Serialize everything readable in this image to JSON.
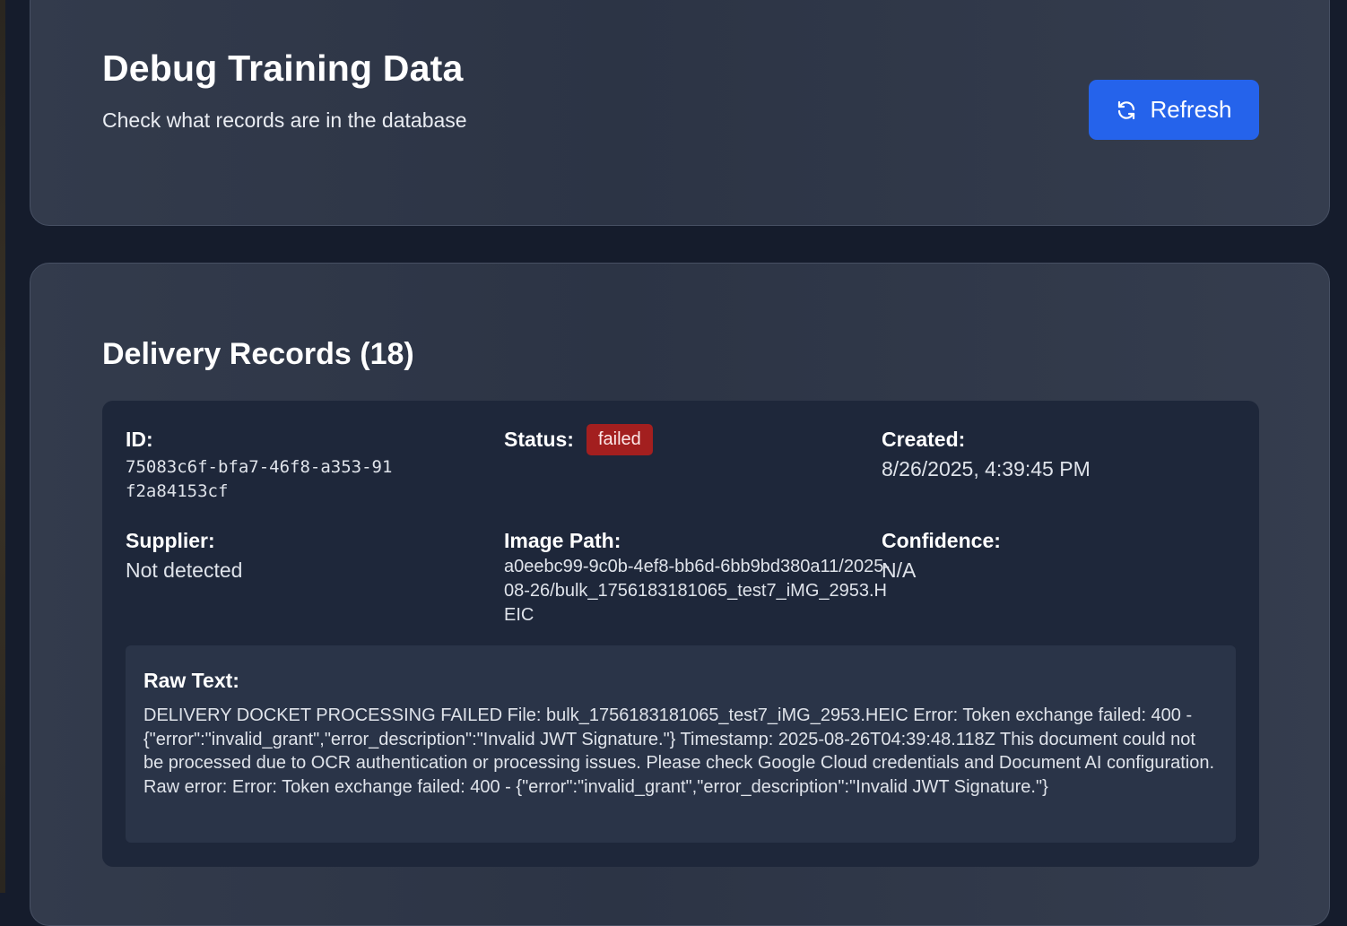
{
  "header": {
    "title": "Debug Training Data",
    "subtitle": "Check what records are in the database",
    "refresh_label": "Refresh"
  },
  "records_section": {
    "title": "Delivery Records (18)",
    "record": {
      "id_label": "ID:",
      "id_value": "75083c6f-bfa7-46f8-a353-91f2a84153cf",
      "status_label": "Status:",
      "status_value": "failed",
      "created_label": "Created:",
      "created_value": "8/26/2025, 4:39:45 PM",
      "supplier_label": "Supplier:",
      "supplier_value": "Not detected",
      "image_path_label": "Image Path:",
      "image_path_value": "a0eebc99-9c0b-4ef8-bb6d-6bb9bd380a11/2025-08-26/bulk_1756183181065_test7_iMG_2953.HEIC",
      "confidence_label": "Confidence:",
      "confidence_value": "N/A",
      "raw_text_label": "Raw Text:",
      "raw_text_value": "DELIVERY DOCKET PROCESSING FAILED File: bulk_1756183181065_test7_iMG_2953.HEIC Error: Token exchange failed: 400 - {\"error\":\"invalid_grant\",\"error_description\":\"Invalid JWT Signature.\"} Timestamp: 2025-08-26T04:39:48.118Z This document could not be processed due to OCR authentication or processing issues. Please check Google Cloud credentials and Document AI configuration. Raw error: Error: Token exchange failed: 400 - {\"error\":\"invalid_grant\",\"error_description\":\"Invalid JWT Signature.\"}"
    }
  },
  "colors": {
    "accent": "#2563eb",
    "status_failed": "#a31f1f",
    "page_bg": "#151c2c",
    "card_bg": "#2f3747",
    "record_bg": "#1e273a"
  },
  "icons": {
    "refresh": "refresh-icon"
  }
}
